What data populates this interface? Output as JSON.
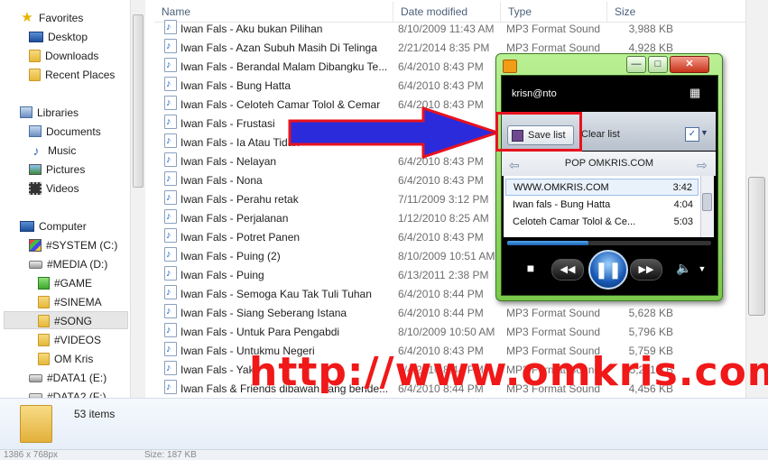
{
  "nav": {
    "favorites": "Favorites",
    "desktop": "Desktop",
    "downloads": "Downloads",
    "recent_places": "Recent Places",
    "libraries": "Libraries",
    "documents": "Documents",
    "music": "Music",
    "pictures": "Pictures",
    "videos": "Videos",
    "computer": "Computer",
    "drives": [
      {
        "label": "#SYSTEM (C:)"
      },
      {
        "label": "#MEDIA (D:)"
      },
      {
        "label": "#GAME"
      },
      {
        "label": "#SINEMA"
      },
      {
        "label": "#SONG"
      },
      {
        "label": "#VIDEOS"
      },
      {
        "label": "OM Kris"
      },
      {
        "label": "#DATA1 (E:)"
      },
      {
        "label": "#DATA2 (F:)"
      }
    ]
  },
  "columns": {
    "name": "Name",
    "date": "Date modified",
    "type": "Type",
    "size": "Size"
  },
  "files": [
    {
      "name": "Iwan Fals - Aku bukan Pilihan",
      "date": "8/10/2009 11:43 AM",
      "type": "MP3 Format Sound",
      "size": "3,988 KB"
    },
    {
      "name": "Iwan Fals - Azan Subuh Masih Di Telinga",
      "date": "2/21/2014 8:35 PM",
      "type": "MP3 Format Sound",
      "size": "4,928 KB"
    },
    {
      "name": "Iwan Fals - Berandal Malam Dibangku Te...",
      "date": "6/4/2010 8:43 PM",
      "type": "",
      "size": ""
    },
    {
      "name": "Iwan Fals - Bung Hatta",
      "date": "6/4/2010 8:43 PM",
      "type": "",
      "size": ""
    },
    {
      "name": "Iwan Fals - Celoteh Camar Tolol & Cemar",
      "date": "6/4/2010 8:43 PM",
      "type": "",
      "size": ""
    },
    {
      "name": "Iwan Fals - Frustasi",
      "date": "",
      "type": "",
      "size": ""
    },
    {
      "name": "Iwan Fals - Ia Atau Tidak",
      "date": "",
      "type": "",
      "size": ""
    },
    {
      "name": "Iwan Fals - Nelayan",
      "date": "6/4/2010 8:43 PM",
      "type": "",
      "size": ""
    },
    {
      "name": "Iwan Fals - Nona",
      "date": "6/4/2010 8:43 PM",
      "type": "",
      "size": ""
    },
    {
      "name": "Iwan Fals - Perahu retak",
      "date": "7/11/2009 3:12 PM",
      "type": "",
      "size": ""
    },
    {
      "name": "Iwan Fals - Perjalanan",
      "date": "1/12/2010 8:25 AM",
      "type": "",
      "size": ""
    },
    {
      "name": "Iwan Fals - Potret Panen",
      "date": "6/4/2010 8:43 PM",
      "type": "",
      "size": ""
    },
    {
      "name": "Iwan Fals - Puing (2)",
      "date": "8/10/2009 10:51 AM",
      "type": "",
      "size": ""
    },
    {
      "name": "Iwan Fals - Puing",
      "date": "6/13/2011 2:38 PM",
      "type": "",
      "size": ""
    },
    {
      "name": "Iwan Fals - Semoga Kau Tak Tuli Tuhan",
      "date": "6/4/2010 8:44 PM",
      "type": "",
      "size": ""
    },
    {
      "name": "Iwan Fals - Siang Seberang Istana",
      "date": "6/4/2010 8:44 PM",
      "type": "MP3 Format Sound",
      "size": "5,628 KB"
    },
    {
      "name": "Iwan Fals - Untuk Para Pengabdi",
      "date": "8/10/2009 10:50 AM",
      "type": "MP3 Format Sound",
      "size": "5,796 KB"
    },
    {
      "name": "Iwan Fals - Untukmu Negeri",
      "date": "6/4/2010 8:43 PM",
      "type": "MP3 Format Sound",
      "size": "5,759 KB"
    },
    {
      "name": "Iwan Fals - Yaki",
      "date": "6/4/2010 8:44 PM",
      "type": "MP3 Format Sound",
      "size": "5,211 KB"
    },
    {
      "name": "Iwan Fals & Friends dibawah tiang bende...",
      "date": "6/4/2010 8:44 PM",
      "type": "MP3 Format Sound",
      "size": "4,456 KB"
    }
  ],
  "status": {
    "count": "53 items"
  },
  "bottom": {
    "left": "1386 x 768px",
    "right": "Size: 187 KB"
  },
  "wmp": {
    "user": "krisn@nto",
    "save_list": "Save list",
    "clear_list": "Clear list",
    "playlist_title": "POP OMKRIS.COM",
    "tracks": [
      {
        "title": "WWW.OMKRIS.COM",
        "duration": "3:42"
      },
      {
        "title": "Iwan fals - Bung Hatta",
        "duration": "4:04"
      },
      {
        "title": "Celoteh Camar Tolol & Ce...",
        "duration": "5:03"
      }
    ],
    "progress": 0.4
  },
  "watermark": "http://www.omkris.com",
  "colors": {
    "accent_red": "#e8121e",
    "arrow_blue": "#2b2bdc",
    "wmp_green": "#79c94a"
  }
}
